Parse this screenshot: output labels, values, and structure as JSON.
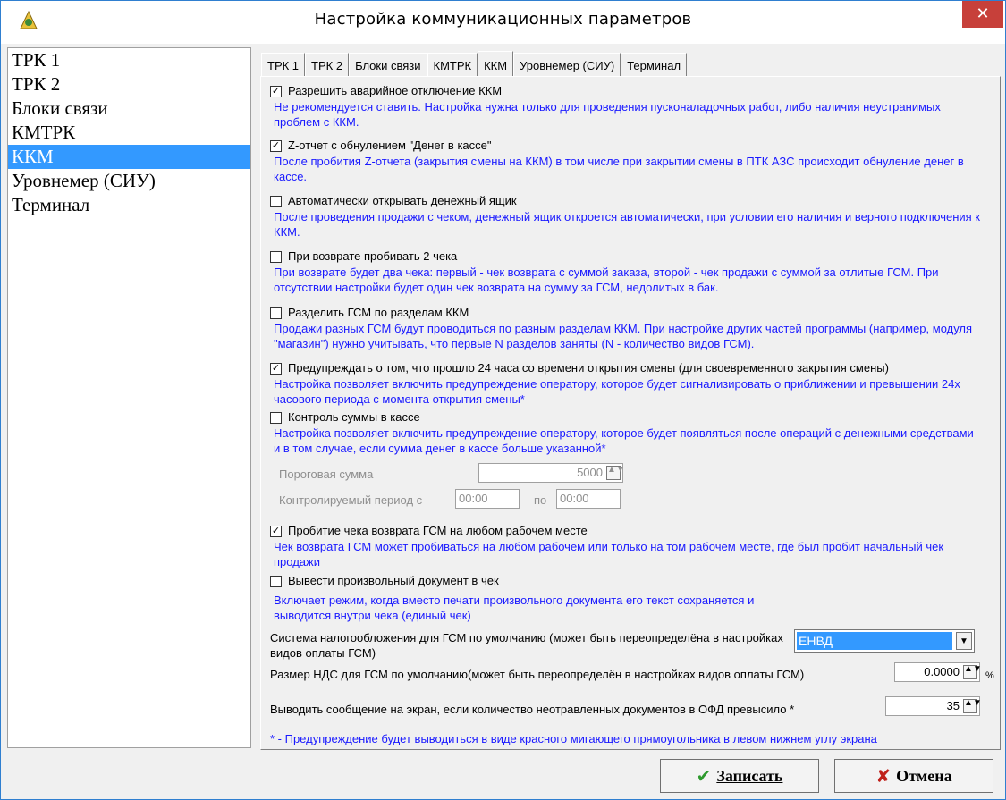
{
  "window": {
    "title": "Настройка коммуникационных параметров",
    "close": "✕"
  },
  "sidebar": {
    "items": [
      {
        "label": "ТРК 1"
      },
      {
        "label": "ТРК 2"
      },
      {
        "label": "Блоки связи"
      },
      {
        "label": "КМТРК"
      },
      {
        "label": "ККМ",
        "selected": true
      },
      {
        "label": "Уровнемер (СИУ)"
      },
      {
        "label": "Терминал"
      }
    ]
  },
  "tabs": [
    {
      "label": "ТРК 1"
    },
    {
      "label": "ТРК 2"
    },
    {
      "label": "Блоки связи"
    },
    {
      "label": "КМТРК"
    },
    {
      "label": "ККМ",
      "active": true
    },
    {
      "label": "Уровнемер (СИУ)"
    },
    {
      "label": "Терминал"
    }
  ],
  "options": [
    {
      "label": "Разрешить аварийное отключение ККМ",
      "checked": true,
      "desc": "Не рекомендуется ставить. Настройка нужна только для проведения пусконаладочных работ, либо наличия неустранимых проблем с ККМ."
    },
    {
      "label": "Z-отчет с обнулением \"Денег в кассе\"",
      "checked": true,
      "desc": "После пробития Z-отчета (закрытия смены на ККМ) в том числе при закрытии смены в ПТК АЗС происходит обнуление денег в кассе."
    },
    {
      "label": "Автоматически открывать денежный ящик",
      "checked": false,
      "desc": "После проведения продажи с чеком, денежный ящик откроется автоматически, при условии его наличия и верного подключения к ККМ."
    },
    {
      "label": "При возврате пробивать 2 чека",
      "checked": false,
      "desc": "При возврате будет два чека: первый - чек возврата с суммой заказа, второй - чек продажи с суммой за отлитые ГСМ. При отсутствии настройки будет один чек возврата на сумму за ГСМ, недолитых в бак."
    },
    {
      "label": "Разделить ГСМ по разделам ККМ",
      "checked": false,
      "desc": "Продажи разных ГСМ будут проводиться по разным разделам ККМ. При настройке других частей программы (например, модуля \"магазин\") нужно учитывать, что первые N разделов заняты (N - количество видов ГСМ)."
    },
    {
      "label": "Предупреждать о том, что прошло 24 часа со времени открытия смены (для своевременного закрытия смены)",
      "checked": true,
      "desc": "Настройка позволяет включить предупреждение оператору, которое будет сигнализировать о приближении и превышении 24х часового периода с момента открытия смены*"
    },
    {
      "label": "Контроль суммы в кассе",
      "checked": false,
      "desc": "Настройка позволяет включить предупреждение оператору, которое будет появляться после операций с денежными средствами и в том случае, если сумма денег в кассе больше указанной*"
    },
    {
      "label": "Пробитие чека возврата ГСМ на любом рабочем месте",
      "checked": true,
      "desc": "Чек возврата ГСМ может пробиваться на любом рабочем или только на том рабочем месте, где был пробит начальный чек продажи"
    },
    {
      "label": "Вывести произвольный документ в чек",
      "checked": false,
      "desc": "Включает режим, когда вместо печати произвольного документа его текст сохраняется и выводится внутри чека (единый чек)"
    }
  ],
  "cash_control": {
    "threshold_label": "Пороговая сумма",
    "threshold_value": "5000",
    "period_label": "Контролируемый период с",
    "period_from": "00:00",
    "period_to_label": "по",
    "period_to": "00:00"
  },
  "tax": {
    "label": "Система налогообложения для ГСМ по умолчанию (может быть переопределёна в настройках видов оплаты ГСМ)",
    "value": "ЕНВД"
  },
  "vat": {
    "label": "Размер НДС для ГСМ по умолчанию(может быть переопределён в настройках видов оплаты ГСМ)",
    "value": "0.0000",
    "unit": "%"
  },
  "ofd": {
    "label": "Выводить сообщение на экран, если количество неотравленных документов в ОФД превысило *",
    "value": "35"
  },
  "footnote": "* - Предупреждение будет выводиться в виде красного мигающего прямоугольника в левом нижнем углу экрана",
  "buttons": {
    "save": "Записать",
    "cancel": "Отмена"
  },
  "colors": {
    "selection": "#3399ff",
    "desc_text": "#1a1aff",
    "close_button": "#c7403a",
    "save_check": "#2e9a2e",
    "cancel_cross": "#c0201a"
  }
}
